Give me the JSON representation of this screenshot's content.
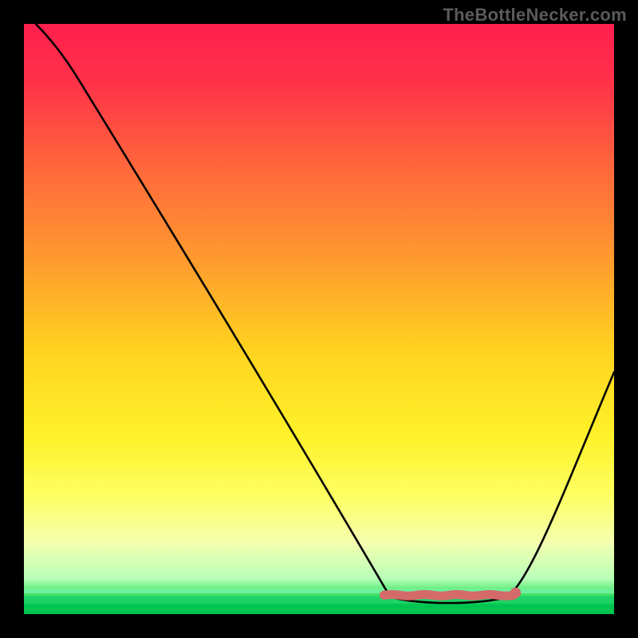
{
  "watermark": "TheBottleNecker.com",
  "chart_data": {
    "type": "line",
    "title": "",
    "xlabel": "",
    "ylabel": "",
    "xlim": [
      0,
      100
    ],
    "ylim": [
      0,
      100
    ],
    "curve": {
      "descent_start": {
        "x": 2,
        "y": 100
      },
      "shoulder": {
        "x": 9,
        "y": 91
      },
      "valley_left": {
        "x": 62,
        "y": 3
      },
      "valley_right": {
        "x": 82,
        "y": 3
      },
      "ascent_end": {
        "x": 100,
        "y": 41
      }
    },
    "marker_band": {
      "x_start": 61,
      "x_end": 83,
      "y": 3.2,
      "color": "#d46a6a"
    },
    "gradient_stops": [
      {
        "offset": 0.0,
        "color": "#ff1f4e"
      },
      {
        "offset": 0.1,
        "color": "#ff3249"
      },
      {
        "offset": 0.25,
        "color": "#ff6a3a"
      },
      {
        "offset": 0.4,
        "color": "#ff9a2f"
      },
      {
        "offset": 0.55,
        "color": "#ffd21f"
      },
      {
        "offset": 0.7,
        "color": "#fff22a"
      },
      {
        "offset": 0.8,
        "color": "#fdff62"
      },
      {
        "offset": 0.88,
        "color": "#f3ffb0"
      },
      {
        "offset": 0.94,
        "color": "#b8ffb8"
      },
      {
        "offset": 0.965,
        "color": "#45e56a"
      },
      {
        "offset": 0.985,
        "color": "#00c84f"
      },
      {
        "offset": 1.0,
        "color": "#00c84f"
      }
    ]
  }
}
